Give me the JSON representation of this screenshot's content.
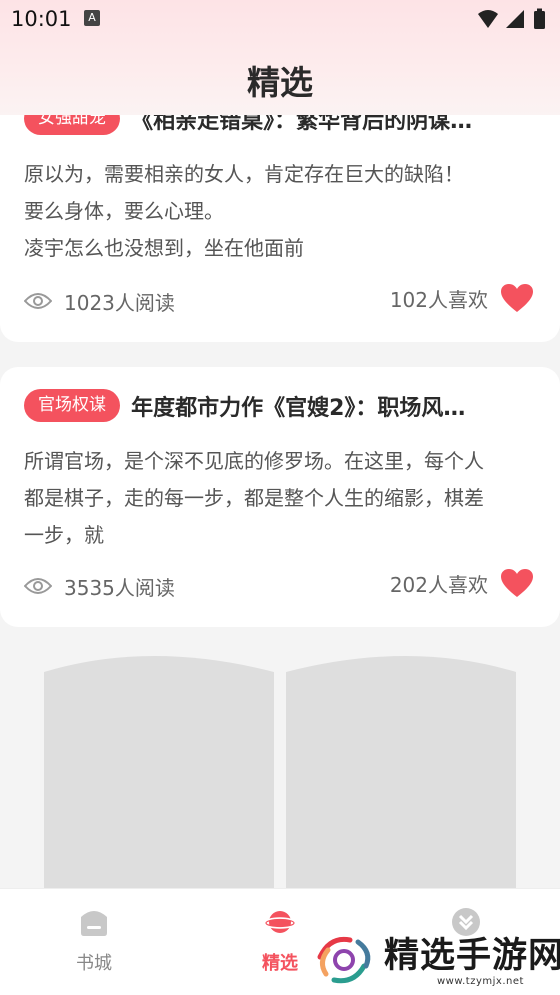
{
  "status_bar": {
    "time": "10:01",
    "notification_icon": "a-icon"
  },
  "header": {
    "title": "精选"
  },
  "cards": [
    {
      "tag": "女强甜宠",
      "title": "《相亲走错桌》：繁华背后的阴谋…",
      "excerpt": [
        "原以为，需要相亲的女人，肯定存在巨大的缺陷！",
        "要么身体，要么心理。",
        "凌宇怎么也没想到，坐在他面前"
      ],
      "reads": "1023人阅读",
      "likes": "102人喜欢"
    },
    {
      "tag": "官场权谋",
      "title": "年度都市力作《官嫂2》：职场风…",
      "excerpt": [
        "所谓官场，是个深不见底的修罗场。在这里，每个人",
        "都是棋子，走的每一步，都是整个人生的缩影，棋差",
        "一步，就"
      ],
      "reads": "3535人阅读",
      "likes": "202人喜欢"
    }
  ],
  "tabbar": {
    "tabs": [
      {
        "label": "书城",
        "icon": "bookstore-icon",
        "active": false
      },
      {
        "label": "精选",
        "icon": "planet-icon",
        "active": true
      },
      {
        "label": "",
        "icon": "profile-icon",
        "active": false
      }
    ]
  },
  "watermark": {
    "text": "精选手游网",
    "url": "www.tzymjx.net"
  },
  "colors": {
    "accent": "#f4525e",
    "header_bg": "#fde3e6",
    "page_bg": "#f4f4f4",
    "heart": "#f4525e"
  }
}
